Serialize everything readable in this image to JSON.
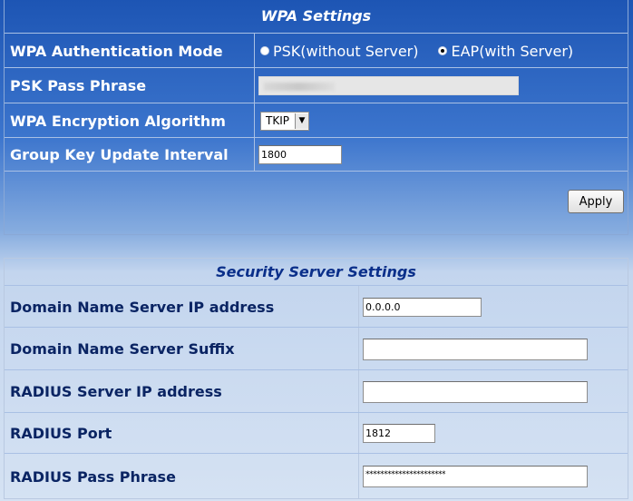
{
  "wpa": {
    "title": "WPA Settings",
    "auth_mode_label": "WPA Authentication Mode",
    "auth_options": [
      {
        "label": "PSK(without Server)",
        "selected": false
      },
      {
        "label": "EAP(with Server)",
        "selected": true
      }
    ],
    "psk_label": "PSK Pass Phrase",
    "enc_label": "WPA Encryption Algorithm",
    "enc_value": "TKIP",
    "group_key_label": "Group Key Update Interval",
    "group_key_value": "1800",
    "apply_label": "Apply"
  },
  "security": {
    "title": "Security Server Settings",
    "dns_ip_label": "Domain Name Server IP address",
    "dns_ip_value": "0.0.0.0",
    "dns_suffix_label": "Domain Name Server Suffix",
    "dns_suffix_value": "",
    "radius_ip_label": "RADIUS Server IP address",
    "radius_ip_value": "",
    "radius_port_label": "RADIUS Port",
    "radius_port_value": "1812",
    "radius_pass_label": "RADIUS Pass Phrase",
    "radius_pass_value": "**********************"
  },
  "colors": {
    "header_blue": "#1d55b4",
    "label_text_dark": "#0a2463",
    "section_title": "#0a2f8a"
  }
}
